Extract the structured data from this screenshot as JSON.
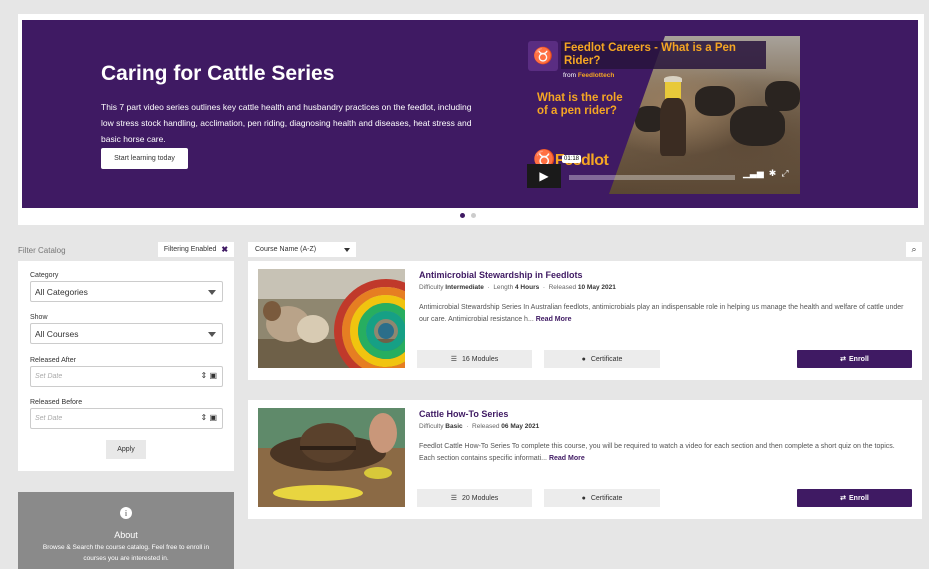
{
  "hero": {
    "title": "Caring for Cattle Series",
    "description": "This 7 part video series outlines key cattle health and husbandry practices on the feedlot, including low stress stock handling, acclimation, pen riding, diagnosing health and diseases, heat stress and basic horse care.",
    "cta_label": "Start learning today",
    "video": {
      "title": "Feedlot Careers - What is a Pen Rider?",
      "from_prefix": "from",
      "from_channel": "Feedlottech",
      "overlay_question": "What is the role of a pen rider?",
      "brand_text": "Feedlot",
      "timestamp": "01:18"
    },
    "carousel_dots": 2,
    "active_dot": 0
  },
  "filter": {
    "header_label": "Filter Catalog",
    "badge_label": "Filtering Enabled",
    "category_label": "Category",
    "category_value": "All Categories",
    "show_label": "Show",
    "show_value": "All Courses",
    "released_after_label": "Released After",
    "released_after_placeholder": "Set Date",
    "released_before_label": "Released Before",
    "released_before_placeholder": "Set Date",
    "apply_label": "Apply"
  },
  "about": {
    "title": "About",
    "text": "Browse & Search the course catalog. Feel free to enroll in courses you are interested in."
  },
  "sort": {
    "value": "Course Name (A-Z)"
  },
  "courses": [
    {
      "title": "Antimicrobial Stewardship in Feedlots",
      "difficulty_label": "Difficulty",
      "difficulty": "Intermediate",
      "length_label": "Length",
      "length": "4 Hours",
      "released_label": "Released",
      "released": "10 May 2021",
      "description": "Antimicrobial Stewardship Series In Australian feedlots, antimicrobials play an indispensable role in helping us manage the health and welfare of cattle under our care. Antimicrobial resistance h...",
      "read_more": "Read More",
      "modules": "16 Modules",
      "certificate": "Certificate",
      "enroll": "Enroll"
    },
    {
      "title": "Cattle How-To Series",
      "difficulty_label": "Difficulty",
      "difficulty": "Basic",
      "released_label": "Released",
      "released": "06 May 2021",
      "description": "Feedlot Cattle How-To Series  To complete this course, you will be required to watch a video for each section and then complete a short quiz on the topics. Each section contains specific informati...",
      "read_more": "Read More",
      "modules": "20 Modules",
      "certificate": "Certificate",
      "enroll": "Enroll"
    }
  ],
  "colors": {
    "brand_purple": "#3f1a63",
    "accent_orange": "#f5a623",
    "page_bg": "#e6e6e6"
  }
}
